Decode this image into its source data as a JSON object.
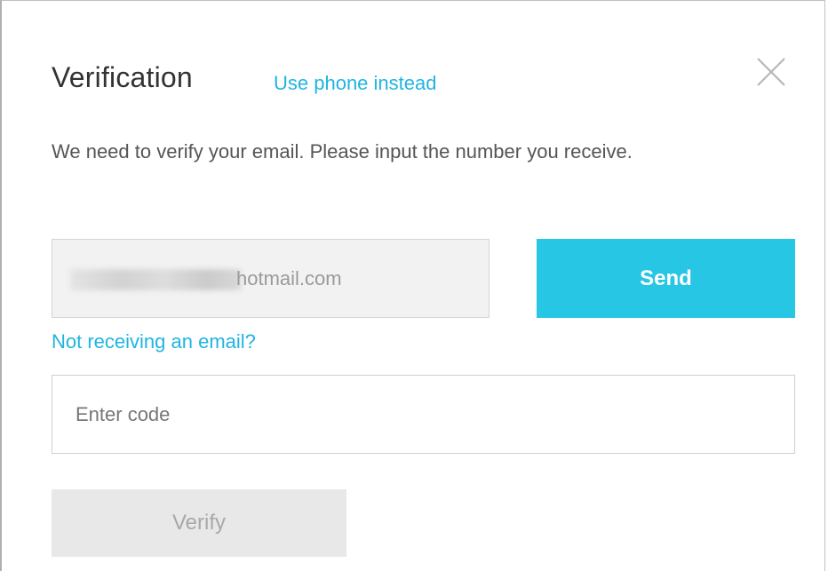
{
  "dialog": {
    "title": "Verification",
    "alternate_link": "Use phone instead",
    "description": "We need to verify your email. Please input the number you receive.",
    "close_icon": "close-icon"
  },
  "email": {
    "value_visible": "hotmail.com",
    "redacted": true
  },
  "send_button": {
    "label": "Send"
  },
  "resend_link": "Not receiving an email?",
  "code": {
    "placeholder": "Enter code",
    "value": ""
  },
  "verify_button": {
    "label": "Verify",
    "disabled": true
  },
  "colors": {
    "accent": "#26c6e4",
    "link": "#1fb5e0",
    "disabled_bg": "#e8e8e8",
    "disabled_text": "#a8a8a8"
  }
}
